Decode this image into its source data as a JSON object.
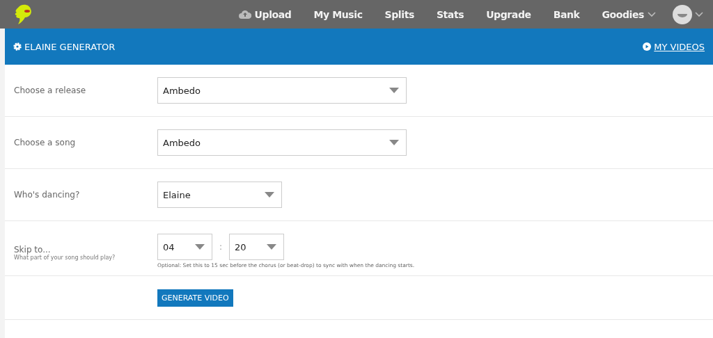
{
  "nav": [
    {
      "label": "Upload",
      "kind": "upload"
    },
    {
      "label": "My Music",
      "kind": "link"
    },
    {
      "label": "Splits",
      "kind": "link"
    },
    {
      "label": "Stats",
      "kind": "link"
    },
    {
      "label": "Upgrade",
      "kind": "link"
    },
    {
      "label": "Bank",
      "kind": "link"
    },
    {
      "label": "Goodies",
      "kind": "dropdown"
    }
  ],
  "header": {
    "title": "ELAINE GENERATOR",
    "link": "MY VIDEOS"
  },
  "rows": [
    {
      "kind": "wide_select",
      "label": "Choose a release",
      "value": "Ambedo"
    },
    {
      "kind": "wide_select",
      "label": "Choose a song",
      "value": "Ambedo"
    },
    {
      "kind": "narrow_select",
      "label": "Who's dancing?",
      "value": "Elaine"
    },
    {
      "kind": "time",
      "label": "Skip to...",
      "sublabel": "What part of your song should play?",
      "minutes": "04",
      "separator": ":",
      "seconds": "20",
      "hint": "Optional: Set this to 15 sec before the chorus (or beat-drop) to sync with when the dancing starts."
    },
    {
      "kind": "button",
      "label": "GENERATE VIDEO"
    }
  ]
}
